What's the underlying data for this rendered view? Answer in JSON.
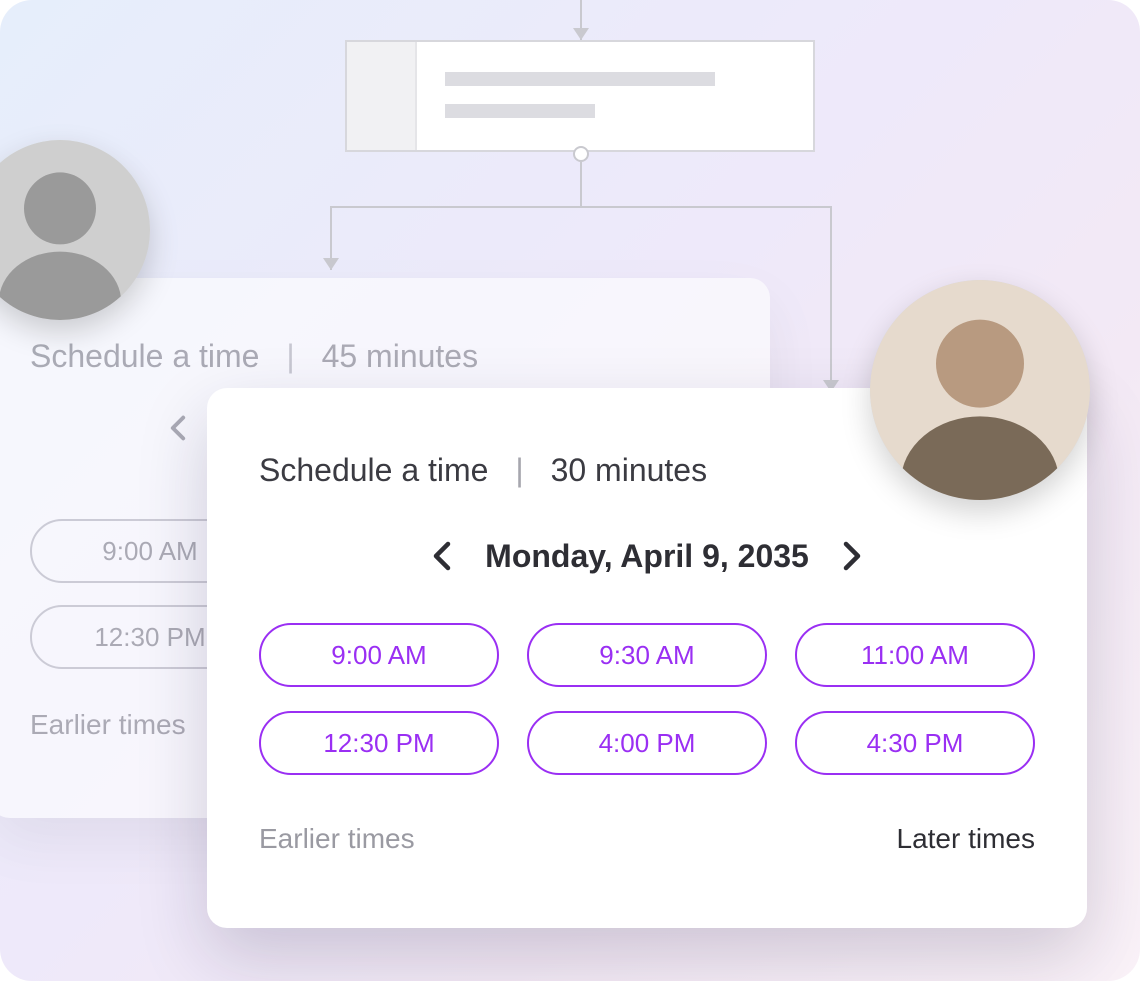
{
  "back_card": {
    "title": "Schedule a time",
    "duration": "45 minutes",
    "slots": [
      "9:00 AM",
      "12:30 PM"
    ],
    "earlier_label": "Earlier times"
  },
  "front_card": {
    "title": "Schedule a time",
    "duration": "30 minutes",
    "date": "Monday, April 9, 2035",
    "slots": [
      "9:00 AM",
      "9:30 AM",
      "11:00 AM",
      "12:30 PM",
      "4:00 PM",
      "4:30 PM"
    ],
    "earlier_label": "Earlier times",
    "later_label": "Later times"
  },
  "separator": "|"
}
